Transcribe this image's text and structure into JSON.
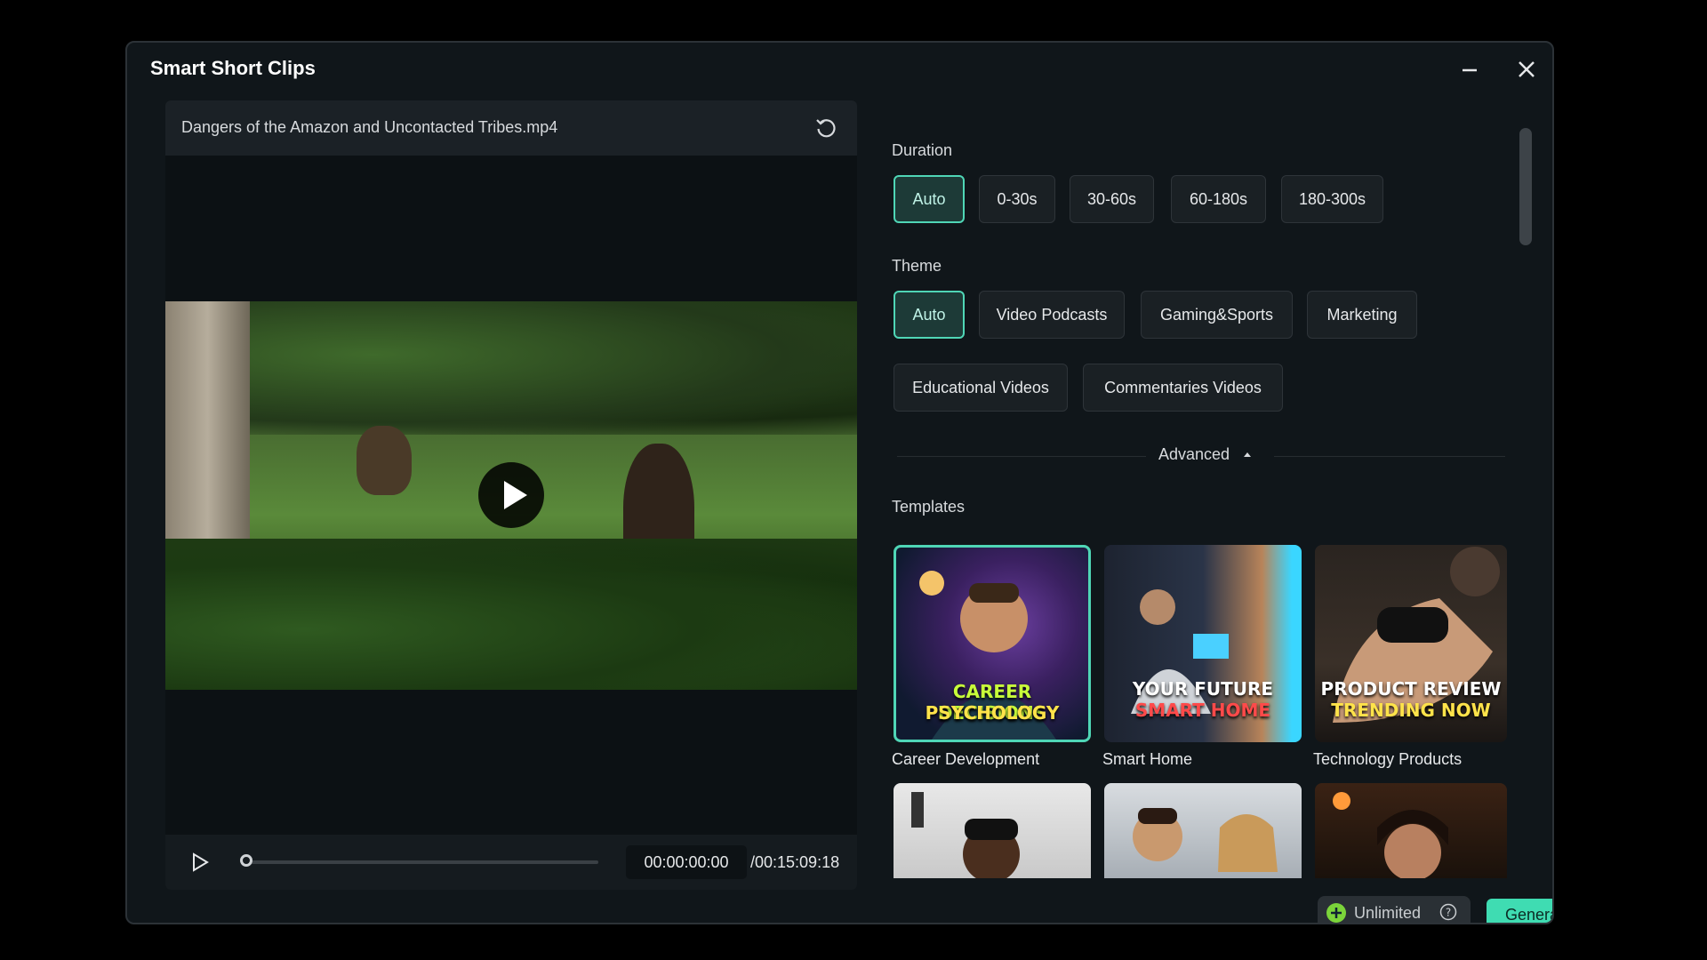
{
  "window": {
    "title": "Smart Short Clips"
  },
  "player": {
    "filename": "Dangers of the Amazon and Uncontacted Tribes.mp4",
    "current_time": "00:00:00:00",
    "total_time": "/00:15:09:18",
    "progress": 0
  },
  "duration": {
    "label": "Duration",
    "options": [
      "Auto",
      "0-30s",
      "30-60s",
      "60-180s",
      "180-300s"
    ],
    "selected": "Auto"
  },
  "theme": {
    "label": "Theme",
    "options": [
      "Auto",
      "Video Podcasts",
      "Gaming&Sports",
      "Marketing",
      "Educational Videos",
      "Commentaries Videos"
    ],
    "selected": "Auto"
  },
  "advanced": {
    "label": "Advanced"
  },
  "templates": {
    "label": "Templates",
    "items": [
      {
        "name": "Career Development",
        "headline1": "CAREER DECISIONS",
        "headline2": "PSYCHOLOGY"
      },
      {
        "name": "Smart Home",
        "headline1": "YOUR FUTURE",
        "headline2": "SMART HOME"
      },
      {
        "name": "Technology Products",
        "headline1": "PRODUCT REVIEW",
        "headline2": "TRENDING NOW"
      }
    ],
    "selected": "Career Development"
  },
  "footer": {
    "credits_label": "Unlimited",
    "generate_label": "Generate"
  },
  "colors": {
    "accent": "#4fd6b6",
    "generate": "#3fdcb2",
    "background": "#10161a"
  }
}
